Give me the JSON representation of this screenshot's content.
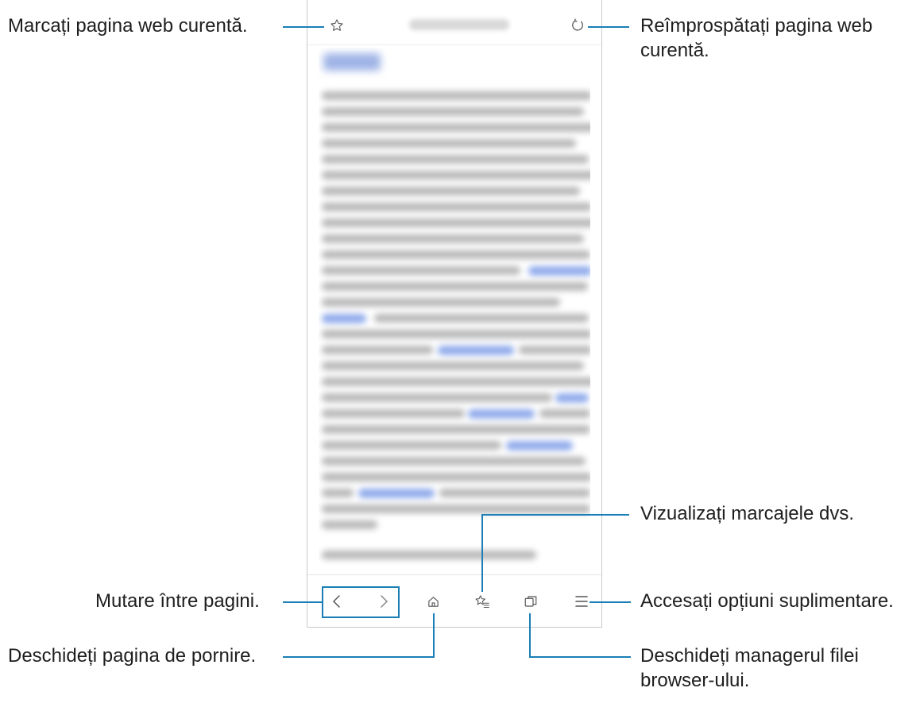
{
  "annotations": {
    "bookmark_current": "Marcați pagina web curentă.",
    "refresh_line1": "Reîmprospătați pagina web",
    "refresh_line2": "curentă.",
    "view_bookmarks": "Vizualizați marcajele dvs.",
    "move_pages": "Mutare între pagini.",
    "more_options": "Accesați opțiuni suplimentare.",
    "open_home": "Deschideți pagina de pornire.",
    "tab_manager_line1": "Deschideți managerul filei",
    "tab_manager_line2": "browser-ului."
  },
  "icons": {
    "bookmark": "star-outline-icon",
    "refresh": "refresh-icon",
    "back": "chevron-left-icon",
    "forward": "chevron-right-icon",
    "home": "home-icon",
    "bookmarks_list": "star-list-icon",
    "tabs": "tabs-icon",
    "menu": "menu-icon"
  },
  "colors": {
    "callout": "#1b7fb5"
  }
}
